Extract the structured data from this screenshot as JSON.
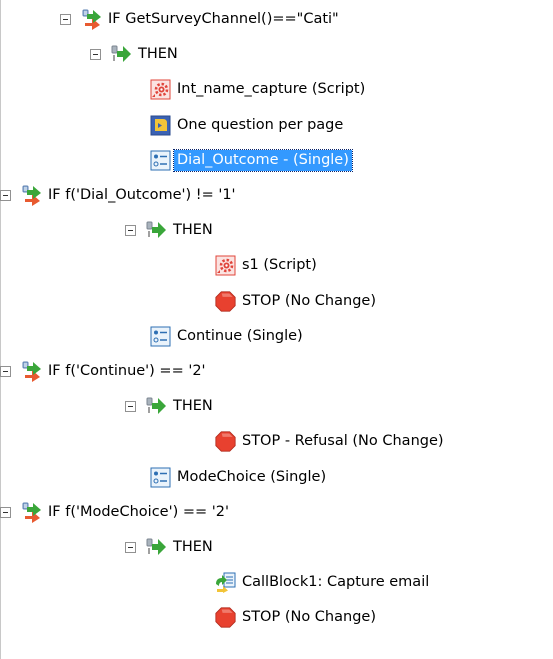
{
  "tree": {
    "nodes": [
      {
        "id": "n0",
        "label": "IF GetSurveyChannel()==\"Cati\"",
        "icon": "if-condition-icon",
        "level": 0,
        "expander": true
      },
      {
        "id": "n1",
        "label": "THEN",
        "icon": "then-branch-icon",
        "level": 1,
        "expander": true
      },
      {
        "id": "n2",
        "label": "Int_name_capture (Script)",
        "icon": "script-icon",
        "level": 2,
        "expander": false
      },
      {
        "id": "n3",
        "label": "One question per page",
        "icon": "page-break-icon",
        "level": 2,
        "expander": false
      },
      {
        "id": "n4",
        "label": "Dial_Outcome - (Single)",
        "icon": "single-question-icon",
        "level": 2,
        "expander": false,
        "selected": true
      },
      {
        "id": "n5",
        "label": "IF f('Dial_Outcome') != '1'",
        "icon": "if-condition-icon",
        "level": 2,
        "expander": true
      },
      {
        "id": "n6",
        "label": "THEN",
        "icon": "then-branch-icon",
        "level": 3,
        "expander": true
      },
      {
        "id": "n7",
        "label": "s1 (Script)",
        "icon": "script-icon",
        "level": 4,
        "expander": false
      },
      {
        "id": "n8",
        "label": "STOP (No Change)",
        "icon": "stop-icon",
        "level": 4,
        "expander": false
      },
      {
        "id": "n9",
        "label": "Continue (Single)",
        "icon": "single-question-icon",
        "level": 2,
        "expander": false
      },
      {
        "id": "n10",
        "label": "IF f('Continue') == '2'",
        "icon": "if-condition-icon",
        "level": 2,
        "expander": true
      },
      {
        "id": "n11",
        "label": "THEN",
        "icon": "then-branch-icon",
        "level": 3,
        "expander": true
      },
      {
        "id": "n12",
        "label": "STOP - Refusal (No Change)",
        "icon": "stop-icon",
        "level": 4,
        "expander": false
      },
      {
        "id": "n13",
        "label": "ModeChoice (Single)",
        "icon": "single-question-icon",
        "level": 2,
        "expander": false
      },
      {
        "id": "n14",
        "label": "IF f('ModeChoice') == '2'",
        "icon": "if-condition-icon",
        "level": 2,
        "expander": true
      },
      {
        "id": "n15",
        "label": "THEN",
        "icon": "then-branch-icon",
        "level": 3,
        "expander": true
      },
      {
        "id": "n16",
        "label": "CallBlock1: Capture email",
        "icon": "call-block-icon",
        "level": 4,
        "expander": false
      },
      {
        "id": "n17",
        "label": "STOP (No Change)",
        "icon": "stop-icon",
        "level": 4,
        "expander": false
      }
    ]
  },
  "colors": {
    "selection": "#3399ff",
    "script": "#e0443a",
    "stop": "#e8412f",
    "question_border": "#2e6fb3",
    "arrow": "#3aa63a"
  }
}
